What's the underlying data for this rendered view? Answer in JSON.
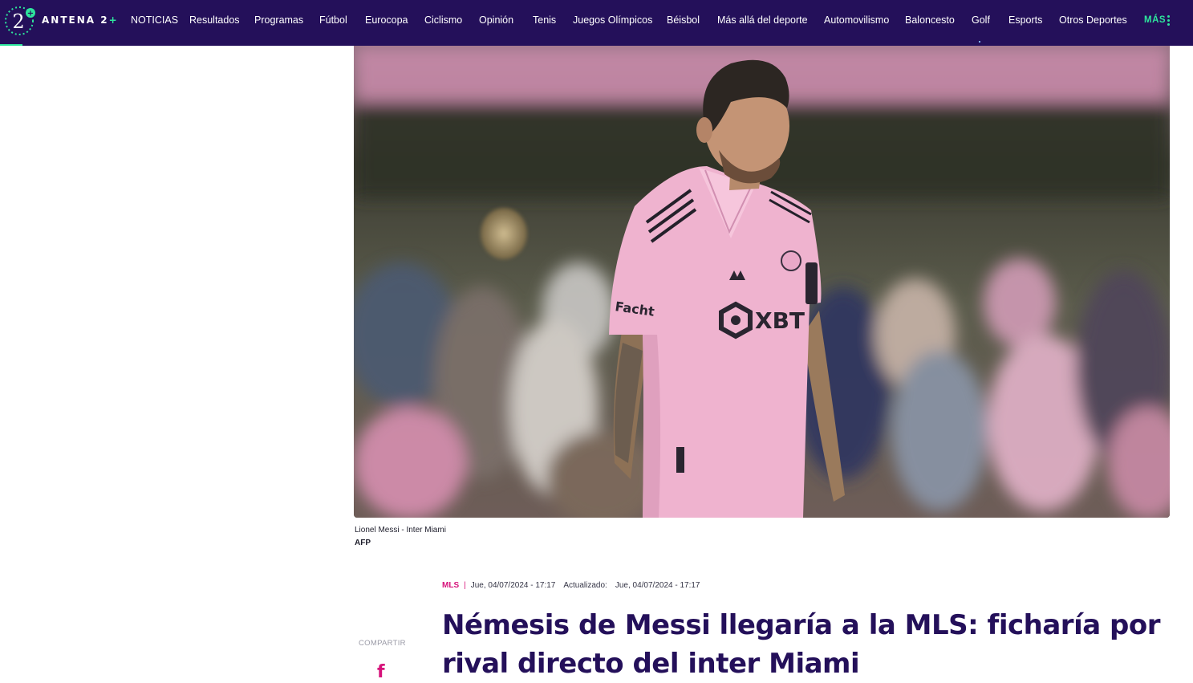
{
  "brand": {
    "name": "ANTENA 2",
    "suffix": "+",
    "logo_numeral": "2"
  },
  "nav": {
    "items": [
      "NOTICIAS",
      "Resultados",
      "Programas",
      "Fútbol",
      "Eurocopa",
      "Ciclismo",
      "Opinión",
      "Tenis",
      "Juegos Olímpicos",
      "Béisbol",
      "Más allá del deporte",
      "Automovilismo",
      "Baloncesto",
      "Golf",
      "Esports",
      "Otros Deportes"
    ],
    "more_label": "MÁS"
  },
  "colors": {
    "navbar": "#24105a",
    "accent_green": "#2ee59d",
    "accent_pink": "#d6127a",
    "headline": "#24105a"
  },
  "image": {
    "caption": "Lionel Messi - Inter Miami",
    "credit": "AFP",
    "jersey_sponsor": "Facht",
    "jersey_logo": "XBT"
  },
  "article": {
    "category": "MLS",
    "separator": "|",
    "published": "Jue, 04/07/2024 - 17:17",
    "updated_label": "Actualizado:",
    "updated": "Jue, 04/07/2024 - 17:17",
    "headline": "Némesis de Messi llegaría a la MLS: ficharía por rival directo del inter Miami"
  },
  "share": {
    "label": "COMPARTIR",
    "facebook_glyph": "f",
    "facebook_icon": "facebook-icon"
  }
}
